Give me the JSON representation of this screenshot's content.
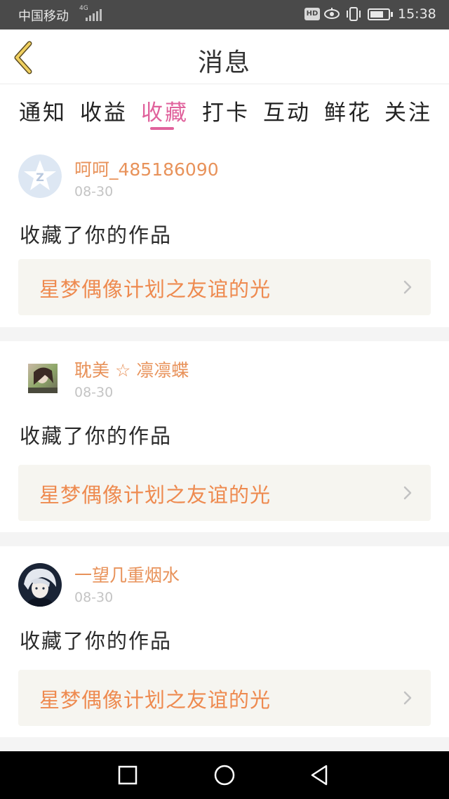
{
  "status_bar": {
    "carrier": "中国移动",
    "network": "4G",
    "hd_badge": "HD",
    "time": "15:38"
  },
  "header": {
    "title": "消息",
    "back_icon": "chevron-left-icon"
  },
  "tabs": [
    {
      "label": "通知",
      "active": false
    },
    {
      "label": "收益",
      "active": false
    },
    {
      "label": "收藏",
      "active": true
    },
    {
      "label": "打卡",
      "active": false
    },
    {
      "label": "互动",
      "active": false
    },
    {
      "label": "鲜花",
      "active": false
    },
    {
      "label": "关注",
      "active": false
    }
  ],
  "messages": [
    {
      "username": "呵呵_485186090",
      "date": "08-30",
      "action": "收藏了你的作品",
      "work_title": "星梦偶像计划之友谊的光",
      "avatar": "default-avatar-icon"
    },
    {
      "username": "耽美 ☆ 凛凛蝶",
      "date": "08-30",
      "action": "收藏了你的作品",
      "work_title": "星梦偶像计划之友谊的光",
      "avatar": "user-photo"
    },
    {
      "username": "一望几重烟水",
      "date": "08-30",
      "action": "收藏了你的作品",
      "work_title": "星梦偶像计划之友谊的光",
      "avatar": "user-photo"
    }
  ],
  "colors": {
    "accent": "#e0629c",
    "username": "#e8925a",
    "work_title": "#ee8a4f",
    "back_arrow": "#d9b24a"
  }
}
